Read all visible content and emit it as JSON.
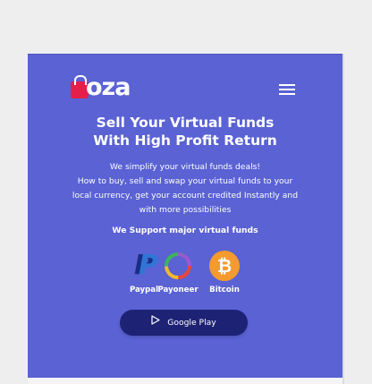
{
  "header": {
    "logo_text": "oza",
    "menu_icon": "hamburger-menu-icon"
  },
  "hero": {
    "headline_line1": "Sell Your Virtual Funds",
    "headline_line2": "With High Profit Return",
    "tagline": "We simplify your virtual funds deals!",
    "description": "How to buy, sell and swap your virtual funds to your local currency, get your account credited Instantly and with more possibilities"
  },
  "support": {
    "title": "We Support major virtual funds",
    "methods": [
      {
        "label": "Paypal",
        "icon": "paypal-icon"
      },
      {
        "label": "Payoneer",
        "icon": "payoneer-icon"
      },
      {
        "label": "Bitcoin",
        "icon": "bitcoin-icon"
      }
    ]
  },
  "cta": {
    "label": "Google Play",
    "icon": "play-icon"
  },
  "colors": {
    "background": "#5a62d4",
    "button": "#1e2274",
    "logo_accent": "#e4204a",
    "bitcoin": "#f59a2e"
  }
}
